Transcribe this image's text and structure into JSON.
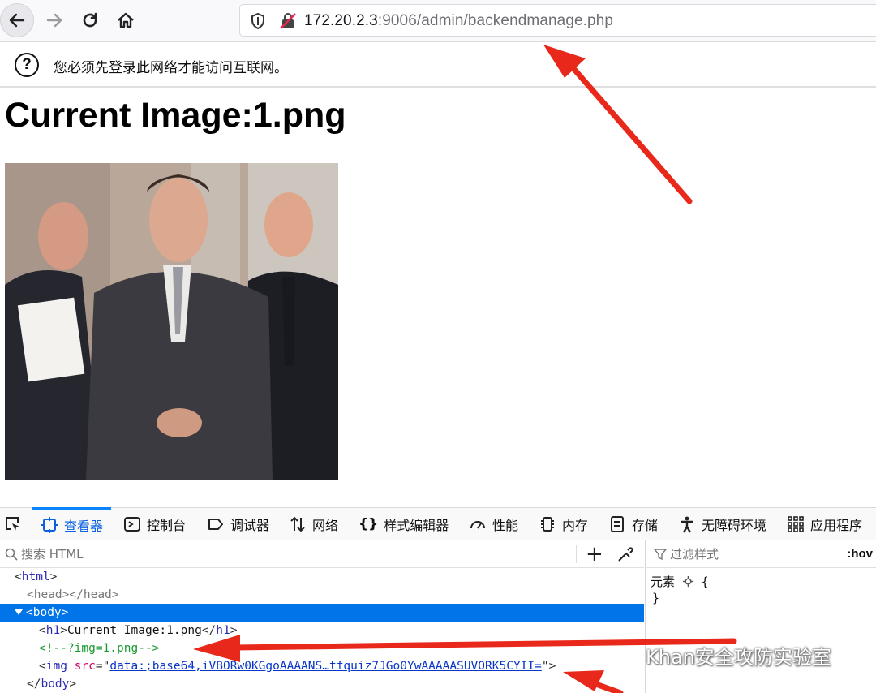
{
  "browser": {
    "url_host": "172.20.2.3",
    "url_path": ":9006/admin/backendmanage.php"
  },
  "notification": {
    "text": "您必须先登录此网络才能访问互联网。"
  },
  "page": {
    "title": "Current Image:1.png"
  },
  "devtools": {
    "tabs": [
      {
        "label": "查看器",
        "icon": "inspector-icon",
        "active": true
      },
      {
        "label": "控制台",
        "icon": "console-icon"
      },
      {
        "label": "调试器",
        "icon": "debugger-icon"
      },
      {
        "label": "网络",
        "icon": "network-icon"
      },
      {
        "label": "样式编辑器",
        "icon": "style-editor-icon"
      },
      {
        "label": "性能",
        "icon": "performance-icon"
      },
      {
        "label": "内存",
        "icon": "memory-icon"
      },
      {
        "label": "存储",
        "icon": "storage-icon"
      },
      {
        "label": "无障碍环境",
        "icon": "accessibility-icon"
      },
      {
        "label": "应用程序",
        "icon": "application-icon"
      }
    ],
    "search_placeholder": "搜索 HTML",
    "filter_placeholder": "过滤样式",
    "hov_label": ":hov",
    "markup": {
      "html_open": "html",
      "head": "head",
      "body_open": "body",
      "h1_text": "Current Image:1.png",
      "h1_tag": "h1",
      "comment": "<!--?img=1.png-->",
      "img_tag": "img",
      "img_attr": "src",
      "img_src": "data:;base64,iVBORw0KGgoAAAANS…tfquiz7JGo0YwAAAAASUVORK5CYII=",
      "body_close": "body"
    },
    "rules": {
      "element_label": "元素",
      "open_brace": "{",
      "close_brace": "}"
    }
  },
  "watermark": {
    "text": "Khan安全攻防实验室"
  },
  "colors": {
    "accent": "#0a84ff",
    "selection": "#0074e8",
    "arrow": "#e8281a"
  }
}
